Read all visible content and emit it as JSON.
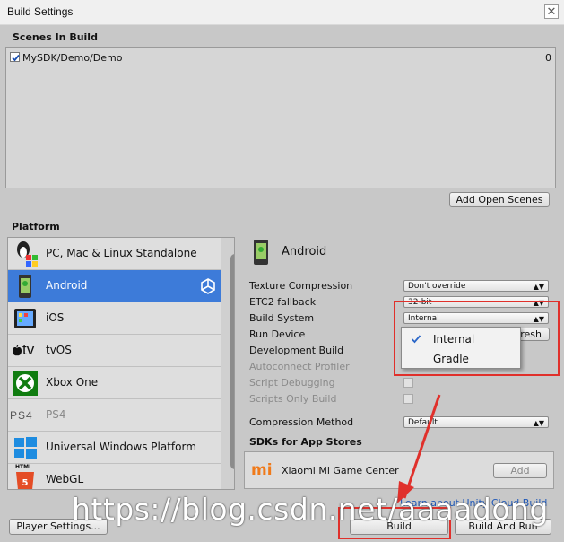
{
  "window": {
    "title": "Build Settings",
    "close_glyph": "✕"
  },
  "scenes": {
    "header": "Scenes In Build",
    "items": [
      {
        "checked": true,
        "path": "MySDK/Demo/Demo",
        "index": "0"
      }
    ],
    "add_open_scenes": "Add Open Scenes"
  },
  "platform": {
    "header": "Platform",
    "items": [
      {
        "label": "PC, Mac & Linux Standalone",
        "icon": "pc-mac-linux-icon"
      },
      {
        "label": "Android",
        "icon": "android-icon",
        "selected": true
      },
      {
        "label": "iOS",
        "icon": "ios-icon"
      },
      {
        "label": "tvOS",
        "icon": "tvos-icon"
      },
      {
        "label": "Xbox One",
        "icon": "xbox-icon"
      },
      {
        "label": "PS4",
        "icon": "ps4-icon"
      },
      {
        "label": "Universal Windows Platform",
        "icon": "windows-icon"
      },
      {
        "label": "WebGL",
        "icon": "html5-icon"
      }
    ],
    "tv_label": "tv",
    "ps4_logo": "PS4",
    "html5_text": "HTML"
  },
  "settings": {
    "platform_title": "Android",
    "texture_compression": {
      "label": "Texture Compression",
      "value": "Don't override"
    },
    "etc2_fallback": {
      "label": "ETC2 fallback",
      "value": "32-bit"
    },
    "build_system": {
      "label": "Build System",
      "value": "Internal"
    },
    "run_device": {
      "label": "Run Device",
      "refresh": "Refresh"
    },
    "development_build": {
      "label": "Development Build"
    },
    "autoconnect_profiler": {
      "label": "Autoconnect Profiler"
    },
    "script_debugging": {
      "label": "Script Debugging"
    },
    "scripts_only_build": {
      "label": "Scripts Only Build"
    },
    "compression_method": {
      "label": "Compression Method",
      "value": "Default"
    },
    "build_system_menu": {
      "options": [
        "Internal",
        "Gradle"
      ],
      "selected": "Internal"
    }
  },
  "sdks": {
    "header": "SDKs for App Stores",
    "items": [
      {
        "name": "Xiaomi Mi Game Center",
        "action": "Add",
        "logo_text": "mi"
      }
    ],
    "learn_link": "Learn about Unity Cloud Build"
  },
  "footer": {
    "player_settings": "Player Settings...",
    "build": "Build",
    "build_and_run": "Build And Run"
  },
  "watermark": "https://blog.csdn.net/aaaadong",
  "colors": {
    "selected": "#3d7bd9",
    "highlight_box": "#e0302b",
    "arrow": "#e0302b"
  }
}
